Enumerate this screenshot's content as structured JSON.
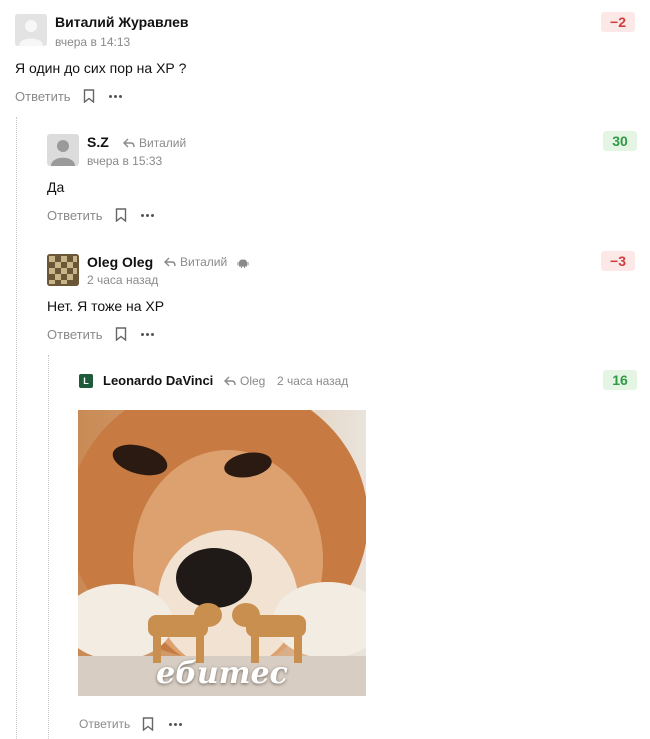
{
  "comments": [
    {
      "author": "Виталий Журавлев",
      "time": "вчера в 14:13",
      "text": "Я один до сих пор на ХР ?",
      "rating": "−2",
      "reply_label": "Ответить"
    },
    {
      "author": "S.Z",
      "reply_to": "Виталий",
      "time": "вчера в 15:33",
      "text": "Да",
      "rating": "30",
      "reply_label": "Ответить"
    },
    {
      "author": "Oleg Oleg",
      "reply_to": "Виталий",
      "time": "2 часа назад",
      "text": "Нет. Я тоже на ХР",
      "rating": "−3",
      "reply_label": "Ответить"
    },
    {
      "author": "Leonardo DaVinci",
      "avatar_letter": "L",
      "reply_to": "Oleg",
      "time": "2 часа назад",
      "image_caption": "ебитес",
      "rating": "16",
      "reply_label": "Ответить"
    }
  ],
  "colors": {
    "negative": "#d23c3c",
    "negative_bg": "#fde8e8",
    "positive": "#2e9a44",
    "positive_bg": "#e4f5e4",
    "muted": "#8a8a8a"
  },
  "icons": [
    "reply-arrow-icon",
    "bookmark-icon",
    "more-dots-icon",
    "android-icon",
    "default-avatar-icon"
  ]
}
